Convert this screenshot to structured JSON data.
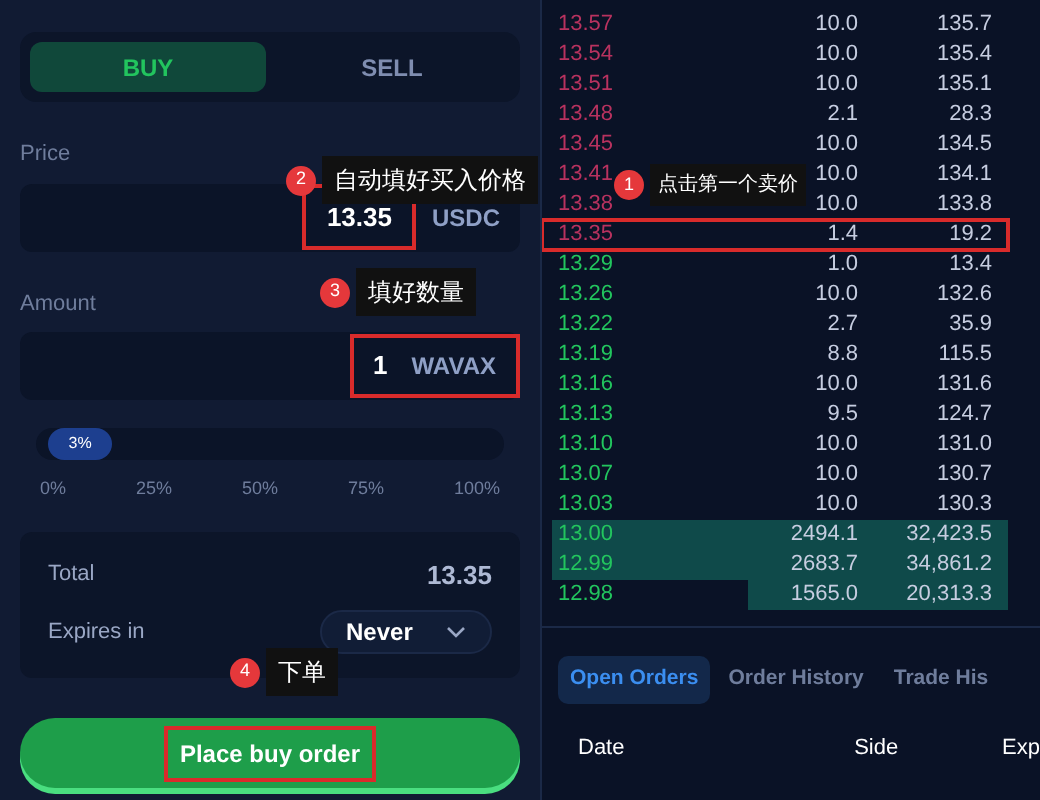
{
  "order_form": {
    "sides": [
      {
        "label": "BUY",
        "selected": true
      },
      {
        "label": "SELL",
        "selected": false
      }
    ],
    "price": {
      "label": "Price",
      "value": "13.35",
      "unit": "USDC",
      "highlighted": true
    },
    "amount": {
      "label": "Amount",
      "value": "1",
      "unit": "WAVAX",
      "highlighted": true
    },
    "slider": {
      "level": 0.03,
      "reading": "3%",
      "ticks": [
        "0%",
        "25%",
        "50%",
        "75%",
        "100%"
      ]
    },
    "total": {
      "label": "Total",
      "value": "13.35"
    },
    "expires": {
      "label": "Expires in",
      "value": "Never"
    },
    "submit": {
      "label": "Place buy order",
      "highlighted": true
    }
  },
  "order_book": {
    "rows": [
      {
        "kind": "sell",
        "price": "13.57",
        "amount": "10.0",
        "total": "135.7",
        "highlighted": false
      },
      {
        "kind": "sell",
        "price": "13.54",
        "amount": "10.0",
        "total": "135.4",
        "highlighted": false
      },
      {
        "kind": "sell",
        "price": "13.51",
        "amount": "10.0",
        "total": "135.1",
        "highlighted": false
      },
      {
        "kind": "sell",
        "price": "13.48",
        "amount": "2.1",
        "total": "28.3",
        "highlighted": false
      },
      {
        "kind": "sell",
        "price": "13.45",
        "amount": "10.0",
        "total": "134.5",
        "highlighted": false
      },
      {
        "kind": "sell",
        "price": "13.41",
        "amount": "10.0",
        "total": "134.1",
        "highlighted": false
      },
      {
        "kind": "sell",
        "price": "13.38",
        "amount": "10.0",
        "total": "133.8",
        "highlighted": false
      },
      {
        "kind": "sell",
        "price": "13.35",
        "amount": "1.4",
        "total": "19.2",
        "highlighted": true
      },
      {
        "kind": "buy",
        "price": "13.29",
        "amount": "1.0",
        "total": "13.4",
        "highlighted": false
      },
      {
        "kind": "buy",
        "price": "13.26",
        "amount": "10.0",
        "total": "132.6",
        "highlighted": false
      },
      {
        "kind": "buy",
        "price": "13.22",
        "amount": "2.7",
        "total": "35.9",
        "highlighted": false
      },
      {
        "kind": "buy",
        "price": "13.19",
        "amount": "8.8",
        "total": "115.5",
        "highlighted": false
      },
      {
        "kind": "buy",
        "price": "13.16",
        "amount": "10.0",
        "total": "131.6",
        "highlighted": false
      },
      {
        "kind": "buy",
        "price": "13.13",
        "amount": "9.5",
        "total": "124.7",
        "highlighted": false
      },
      {
        "kind": "buy",
        "price": "13.10",
        "amount": "10.0",
        "total": "131.0",
        "highlighted": false
      },
      {
        "kind": "buy",
        "price": "13.07",
        "amount": "10.0",
        "total": "130.7",
        "highlighted": false
      },
      {
        "kind": "buy",
        "price": "13.03",
        "amount": "10.0",
        "total": "130.3",
        "highlighted": false
      },
      {
        "kind": "buy",
        "price": "13.00",
        "amount": "2494.1",
        "total": "32,423.5",
        "highlighted": false,
        "level": 0.98
      },
      {
        "kind": "buy",
        "price": "12.99",
        "amount": "2683.7",
        "total": "34,861.2",
        "highlighted": false,
        "level": 0.98
      },
      {
        "kind": "buy",
        "price": "12.98",
        "amount": "1565.0",
        "total": "20,313.3",
        "highlighted": false,
        "level": 0.56
      }
    ]
  },
  "orders": {
    "tabs": [
      {
        "label": "Open Orders",
        "selected": true
      },
      {
        "label": "Order History",
        "selected": false
      },
      {
        "label": "Trade His",
        "selected": false
      }
    ],
    "columns": [
      "Date",
      "Side",
      "Exp"
    ]
  },
  "annotations": [
    {
      "number": "2",
      "text": "自动填好买入价格"
    },
    {
      "number": "1",
      "text": "点击第一个卖价"
    },
    {
      "number": "3",
      "text": "填好数量"
    },
    {
      "number": "4",
      "text": "下单"
    }
  ]
}
